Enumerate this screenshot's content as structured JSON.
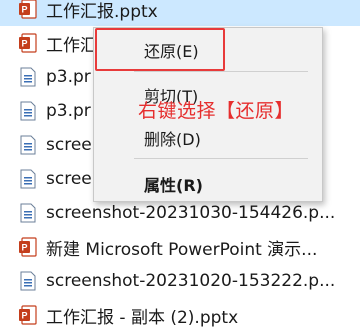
{
  "files": [
    {
      "name": "工作汇报.pptx",
      "icon": "pptx-icon",
      "selected": true
    },
    {
      "name": "工作汇",
      "icon": "pptx-icon",
      "selected": false
    },
    {
      "name": "p3.pr",
      "icon": "image-file-icon",
      "selected": false
    },
    {
      "name": "p3.pr",
      "icon": "image-file-icon",
      "selected": false
    },
    {
      "name": "screen",
      "icon": "image-file-icon",
      "selected": false
    },
    {
      "name": "scree",
      "icon": "image-file-icon",
      "selected": false
    },
    {
      "name": "screenshot-20231030-154426.p...",
      "icon": "image-file-icon",
      "selected": false
    },
    {
      "name": "新建 Microsoft PowerPoint 演示...",
      "icon": "pptx-icon",
      "selected": false
    },
    {
      "name": "screenshot-20231020-153222.p...",
      "icon": "image-file-icon",
      "selected": false
    },
    {
      "name": "工作汇报 - 副本 (2).pptx",
      "icon": "pptx-icon",
      "selected": false
    }
  ],
  "context_menu": {
    "restore": "还原(E)",
    "cut": "剪切(T)",
    "delete": "删除(D)",
    "properties": "属性(R)"
  },
  "annotation": "右键选择【还原】",
  "colors": {
    "selection": "#cce8ff",
    "pptx": "#c43e1c",
    "annotation": "#e62e2e"
  }
}
